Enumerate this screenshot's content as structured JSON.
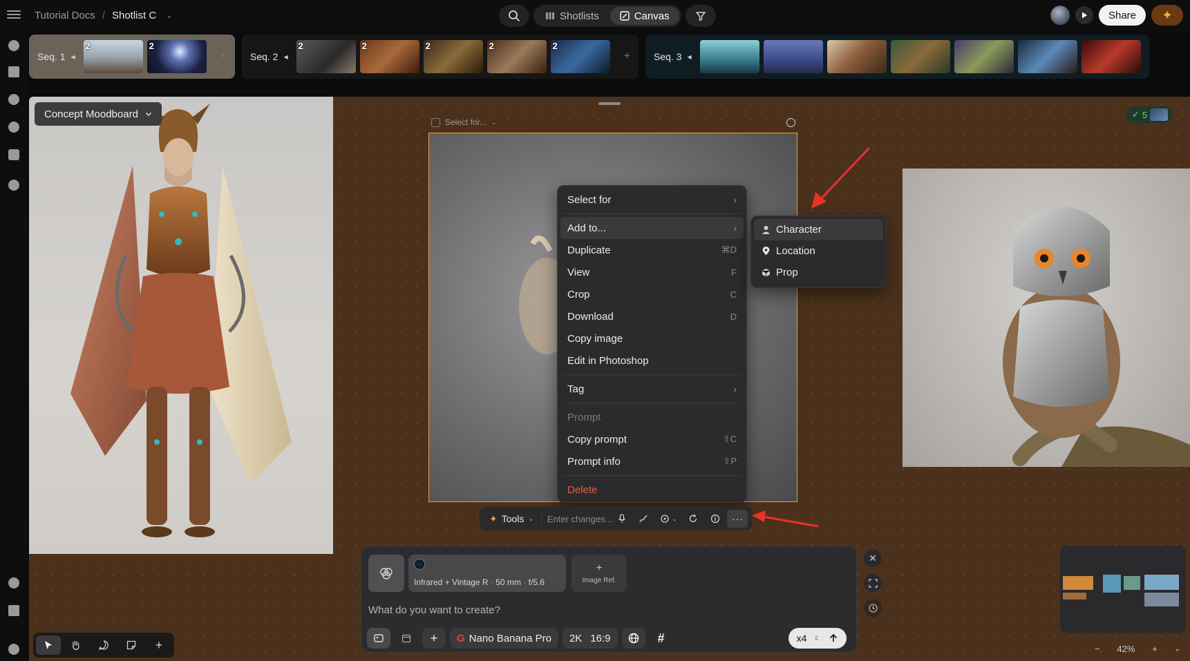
{
  "breadcrumb": {
    "project": "Tutorial Docs",
    "separator": "/",
    "current": "Shotlist C"
  },
  "top_tabs": {
    "shotlists": "Shotlists",
    "canvas": "Canvas"
  },
  "share_label": "Share",
  "sequences": [
    {
      "label": "Seq. 1",
      "thumbs": [
        {
          "num": "2"
        },
        {
          "num": "2"
        }
      ]
    },
    {
      "label": "Seq. 2",
      "thumbs": [
        {
          "num": "2"
        },
        {
          "num": "2"
        },
        {
          "num": "2"
        },
        {
          "num": "2"
        },
        {
          "num": "2"
        }
      ]
    },
    {
      "label": "Seq. 3",
      "thumbs": [
        {},
        {},
        {},
        {},
        {},
        {},
        {}
      ]
    }
  ],
  "canvas": {
    "moodboard_label": "Concept Moodboard",
    "select_for_label": "Select for...",
    "badge_count": "5"
  },
  "context_menu": {
    "select_for": "Select for",
    "add_to": "Add to...",
    "duplicate": {
      "label": "Duplicate",
      "shortcut": "⌘D"
    },
    "view": {
      "label": "View",
      "shortcut": "F"
    },
    "crop": {
      "label": "Crop",
      "shortcut": "C"
    },
    "download": {
      "label": "Download",
      "shortcut": "D"
    },
    "copy_image": "Copy image",
    "edit_photoshop": "Edit in Photoshop",
    "tag": "Tag",
    "prompt_header": "Prompt",
    "copy_prompt": {
      "label": "Copy prompt",
      "shortcut": "⇧C"
    },
    "prompt_info": {
      "label": "Prompt info",
      "shortcut": "⇧P"
    },
    "delete": "Delete"
  },
  "submenu": {
    "character": "Character",
    "location": "Location",
    "prop": "Prop"
  },
  "toolbar": {
    "tools_label": "Tools",
    "input_placeholder": "Enter changes..."
  },
  "prompt_panel": {
    "style_name": "Infrared + Vintage R",
    "lens": "50 mm",
    "aperture": "f/5.6",
    "image_ref": "Image Ref.",
    "placeholder": "What do you want to create?",
    "model": "Nano Banana Pro",
    "resolution": "2K",
    "aspect": "16:9",
    "count": "x4"
  },
  "zoom": {
    "minus": "−",
    "value": "42%",
    "plus": "+"
  },
  "colors": {
    "canvas_bg": "#4b311c",
    "accent_orange": "#e6a23a",
    "delete_red": "#ef5a4a",
    "arrow_red": "#e8322b"
  }
}
